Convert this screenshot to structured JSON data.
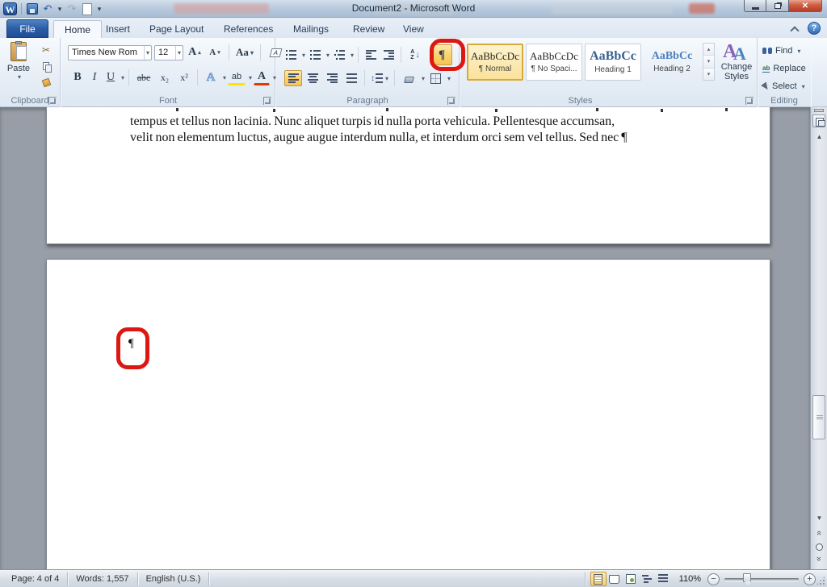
{
  "titlebar": {
    "title": "Document2  -  Microsoft Word"
  },
  "tabs": {
    "file": "File",
    "home": "Home",
    "insert": "Insert",
    "page_layout": "Page Layout",
    "references": "References",
    "mailings": "Mailings",
    "review": "Review",
    "view": "View"
  },
  "ribbon": {
    "clipboard": {
      "label": "Clipboard",
      "paste": "Paste"
    },
    "font": {
      "label": "Font",
      "name": "Times New Rom",
      "size": "12",
      "bold": "B",
      "italic": "I",
      "underline": "U",
      "strike": "abc",
      "subscript": "x₂",
      "superscript": "x²",
      "grow": "A",
      "shrink": "A",
      "change_case": "Aa",
      "effects": "A",
      "highlight": "ab",
      "color": "A"
    },
    "paragraph": {
      "label": "Paragraph",
      "show_hide": "¶"
    },
    "styles": {
      "label": "Styles",
      "normal_preview": "AaBbCcDc",
      "normal_name": "¶ Normal",
      "nospacing_preview": "AaBbCcDc",
      "nospacing_name": "¶ No Spaci...",
      "h1_preview": "AaBbCc",
      "h1_name": "Heading 1",
      "h2_preview": "AaBbCc",
      "h2_name": "Heading 2",
      "change_line1": "Change",
      "change_line2": "Styles"
    },
    "editing": {
      "label": "Editing",
      "find": "Find",
      "replace": "Replace",
      "select": "Select"
    }
  },
  "document": {
    "line1": "tempus et tellus non lacinia. Nunc aliquet turpis id nulla porta vehicula. Pellentesque accumsan,",
    "line2": "velit non elementum luctus, augue augue interdum nulla, et interdum orci sem vel tellus. Sed nec",
    "end_mark": "¶",
    "page_mark": "¶"
  },
  "status": {
    "page": "Page: 4 of 4",
    "words": "Words: 1,557",
    "language": "English (U.S.)",
    "zoom": "110%"
  },
  "colors": {
    "annotation_red": "#dd1712",
    "active_amber": "#f9d172",
    "file_tab_blue": "#2a5ca5",
    "heading1_blue": "#365f91",
    "heading2_blue": "#4f81bd"
  },
  "icons": {
    "dropdown": "▾",
    "up": "▴",
    "scissors": "✂",
    "undo": "↶",
    "redo": "↷",
    "w": "W",
    "help": "?",
    "close": "✕",
    "updown": "↕",
    "sort_a": "A",
    "sort_z": "Z",
    "sort_down": "↓",
    "scroll_up": "▲",
    "scroll_down": "▼",
    "chevron_double": "«",
    "minus": "−",
    "plus": "+",
    "replace_ab": "ab"
  }
}
